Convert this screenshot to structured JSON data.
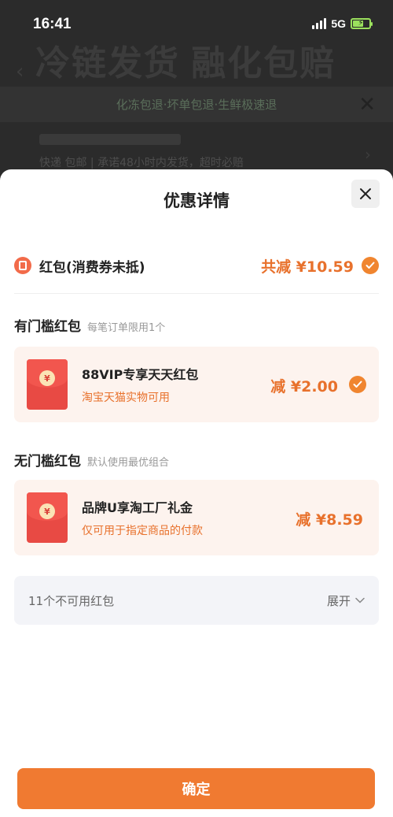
{
  "status_bar": {
    "time": "16:41",
    "network": "5G"
  },
  "background": {
    "banner": "冷链发货 融化包赔",
    "notice": "化冻包退·坏单包退·生鲜极速退",
    "shipping": "快递 包邮 | 承诺48小时内发货，超时必赔"
  },
  "sheet": {
    "title": "优惠详情",
    "summary": {
      "label": "红包(消费券未抵)",
      "amount": "共减 ¥10.59"
    },
    "threshold_section": {
      "title": "有门槛红包",
      "subtitle": "每笔订单限用1个",
      "card": {
        "name": "88VIP专享天天红包",
        "desc": "淘宝天猫实物可用",
        "amount": "减 ¥2.00",
        "coin": "¥"
      }
    },
    "no_threshold_section": {
      "title": "无门槛红包",
      "subtitle": "默认使用最优组合",
      "card": {
        "name": "品牌U享淘工厂礼金",
        "desc": "仅可用于指定商品的付款",
        "amount": "减 ¥8.59",
        "coin": "¥"
      }
    },
    "unavailable": {
      "label": "11个不可用红包",
      "expand": "展开"
    },
    "confirm": "确定"
  },
  "colors": {
    "accent": "#f07a31",
    "accent_text": "#e8712c",
    "card_bg": "#fdf3ee",
    "envelope": "#e84a44"
  },
  "icons": [
    "signal-icon",
    "battery-icon",
    "close-icon",
    "red-packet-icon",
    "check-icon",
    "envelope-icon",
    "chevron-down-icon"
  ]
}
